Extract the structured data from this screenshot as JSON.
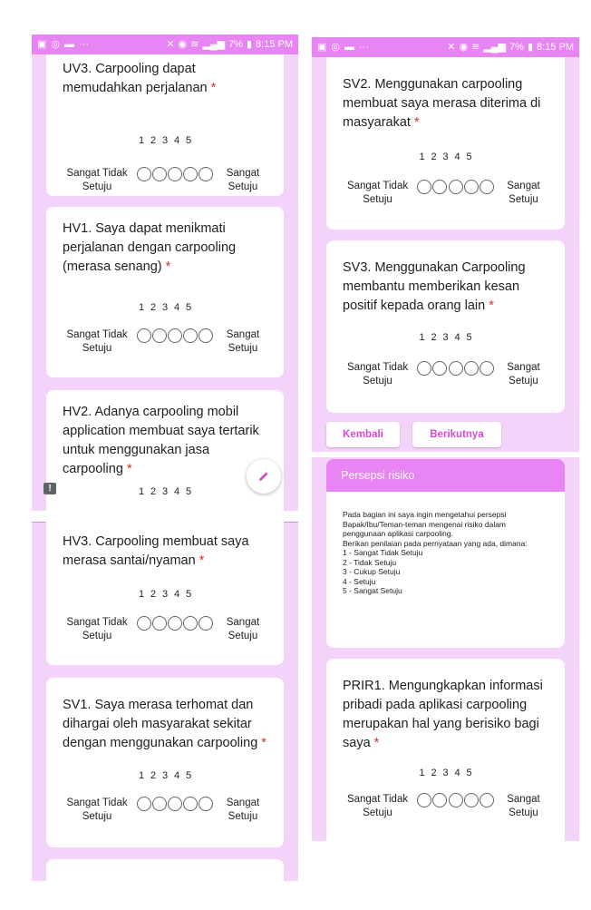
{
  "status_bar": {
    "left_icons": [
      "image-icon",
      "whatsapp-icon",
      "message-icon",
      "more-icon"
    ],
    "right_text": "7%",
    "time": "8:15 PM"
  },
  "scale": {
    "numbers": [
      "1",
      "2",
      "3",
      "4",
      "5"
    ],
    "low_label": "Sangat Tidak Setuju",
    "high_label": "Sangat Setuju"
  },
  "required_marker": "*",
  "questions": {
    "uv3": "UV3. Carpooling dapat memudahkan perjalanan",
    "hv1": "HV1. Saya dapat menikmati perjalanan dengan carpooling (merasa senang)",
    "hv2": "HV2. Adanya carpooling mobil application membuat saya tertarik untuk menggunakan jasa carpooling",
    "hv3": "HV3. Carpooling membuat saya merasa santai/nyaman",
    "sv1": "SV1. Saya merasa terhomat dan dihargai oleh masyarakat sekitar dengan menggunakan carpooling",
    "sv2": "SV2. Menggunakan carpooling membuat saya merasa diterima di masyarakat",
    "sv3": "SV3. Menggunakan Carpooling membantu memberikan kesan positif kepada orang lain",
    "prir1": "PRIR1. Mengungkapkan informasi pribadi pada aplikasi carpooling merupakan hal yang berisiko bagi saya"
  },
  "buttons": {
    "back": "Kembali",
    "next": "Berikutnya"
  },
  "section": {
    "title": "Persepsi risiko",
    "description": "Pada bagian ini saya ingin mengetahui persepsi Bapak/Ibu/Teman-teman mengenai risiko dalam penggunaan aplikasi carpooling.\nBerikan penilaian pada pernyataan yang ada, dimana:\n1 - Sangat Tidak Setuju\n2 - Tidak Setuju\n3 - Cukup Setuju\n4 - Setuju\n5 - Sangat Setuju"
  },
  "colors": {
    "accent": "#e884f4",
    "background": "#f3d3fa",
    "required": "#d93025",
    "button_text": "#d54bd0"
  }
}
